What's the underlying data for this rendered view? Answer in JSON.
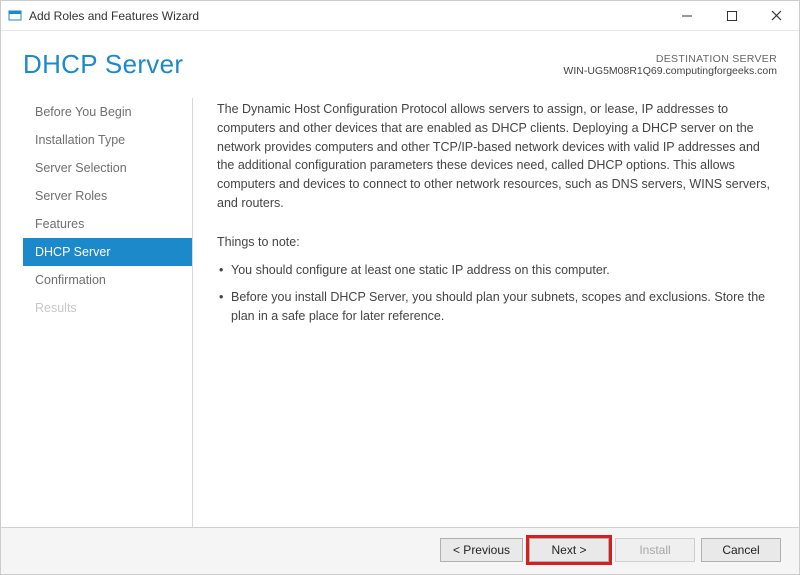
{
  "window": {
    "title": "Add Roles and Features Wizard"
  },
  "header": {
    "page_title": "DHCP Server",
    "destination_label": "DESTINATION SERVER",
    "destination_name": "WIN-UG5M08R1Q69.computingforgeeks.com"
  },
  "sidebar": {
    "items": [
      {
        "label": "Before You Begin",
        "state": "normal"
      },
      {
        "label": "Installation Type",
        "state": "normal"
      },
      {
        "label": "Server Selection",
        "state": "normal"
      },
      {
        "label": "Server Roles",
        "state": "normal"
      },
      {
        "label": "Features",
        "state": "normal"
      },
      {
        "label": "DHCP Server",
        "state": "active"
      },
      {
        "label": "Confirmation",
        "state": "normal"
      },
      {
        "label": "Results",
        "state": "disabled"
      }
    ]
  },
  "body": {
    "intro": "The Dynamic Host Configuration Protocol allows servers to assign, or lease, IP addresses to computers and other devices that are enabled as DHCP clients. Deploying a DHCP server on the network provides computers and other TCP/IP-based network devices with valid IP addresses and the additional configuration parameters these devices need, called DHCP options. This allows computers and devices to connect to other network resources, such as DNS servers, WINS servers, and routers.",
    "things_label": "Things to note:",
    "notes": [
      "You should configure at least one static IP address on this computer.",
      "Before you install DHCP Server, you should plan your subnets, scopes and exclusions. Store the plan in a safe place for later reference."
    ]
  },
  "footer": {
    "previous": "< Previous",
    "next": "Next >",
    "install": "Install",
    "cancel": "Cancel"
  }
}
